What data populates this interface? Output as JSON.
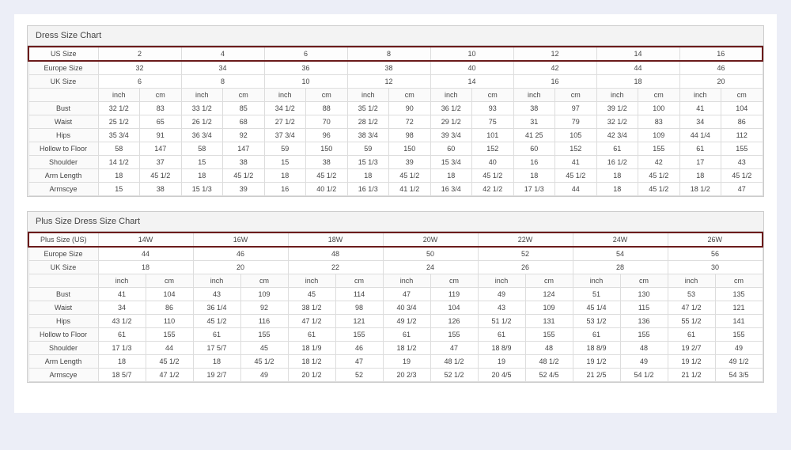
{
  "charts": [
    {
      "title": "Dress Size Chart",
      "rows": [
        {
          "label": "US Size",
          "style": "highlight",
          "span": 2,
          "cells": [
            "2",
            "4",
            "6",
            "8",
            "10",
            "12",
            "14",
            "16"
          ]
        },
        {
          "label": "Europe Size",
          "style": "",
          "span": 2,
          "cells": [
            "32",
            "34",
            "36",
            "38",
            "40",
            "42",
            "44",
            "46"
          ]
        },
        {
          "label": "UK Size",
          "style": "",
          "span": 2,
          "cells": [
            "6",
            "8",
            "10",
            "12",
            "14",
            "16",
            "18",
            "20"
          ]
        },
        {
          "label": "",
          "style": "unit",
          "span": 1,
          "cells": [
            "inch",
            "cm",
            "inch",
            "cm",
            "inch",
            "cm",
            "inch",
            "cm",
            "inch",
            "cm",
            "inch",
            "cm",
            "inch",
            "cm",
            "inch",
            "cm"
          ]
        },
        {
          "label": "Bust",
          "style": "",
          "span": 1,
          "cells": [
            "32 1/2",
            "83",
            "33 1/2",
            "85",
            "34 1/2",
            "88",
            "35 1/2",
            "90",
            "36 1/2",
            "93",
            "38",
            "97",
            "39 1/2",
            "100",
            "41",
            "104"
          ]
        },
        {
          "label": "Waist",
          "style": "",
          "span": 1,
          "cells": [
            "25 1/2",
            "65",
            "26 1/2",
            "68",
            "27 1/2",
            "70",
            "28 1/2",
            "72",
            "29 1/2",
            "75",
            "31",
            "79",
            "32 1/2",
            "83",
            "34",
            "86"
          ]
        },
        {
          "label": "Hips",
          "style": "",
          "span": 1,
          "cells": [
            "35 3/4",
            "91",
            "36 3/4",
            "92",
            "37 3/4",
            "96",
            "38 3/4",
            "98",
            "39 3/4",
            "101",
            "41 25",
            "105",
            "42 3/4",
            "109",
            "44 1/4",
            "112"
          ]
        },
        {
          "label": "Hollow to Floor",
          "style": "",
          "span": 1,
          "cells": [
            "58",
            "147",
            "58",
            "147",
            "59",
            "150",
            "59",
            "150",
            "60",
            "152",
            "60",
            "152",
            "61",
            "155",
            "61",
            "155"
          ]
        },
        {
          "label": "Shoulder",
          "style": "",
          "span": 1,
          "cells": [
            "14 1/2",
            "37",
            "15",
            "38",
            "15",
            "38",
            "15 1/3",
            "39",
            "15 3/4",
            "40",
            "16",
            "41",
            "16 1/2",
            "42",
            "17",
            "43"
          ]
        },
        {
          "label": "Arm Length",
          "style": "",
          "span": 1,
          "cells": [
            "18",
            "45 1/2",
            "18",
            "45 1/2",
            "18",
            "45 1/2",
            "18",
            "45 1/2",
            "18",
            "45 1/2",
            "18",
            "45 1/2",
            "18",
            "45 1/2",
            "18",
            "45 1/2"
          ]
        },
        {
          "label": "Armscye",
          "style": "",
          "span": 1,
          "cells": [
            "15",
            "38",
            "15 1/3",
            "39",
            "16",
            "40 1/2",
            "16 1/3",
            "41 1/2",
            "16 3/4",
            "42 1/2",
            "17 1/3",
            "44",
            "18",
            "45 1/2",
            "18 1/2",
            "47"
          ]
        }
      ]
    },
    {
      "title": "Plus Size Dress Size Chart",
      "rows": [
        {
          "label": "Plus Size (US)",
          "style": "highlight",
          "span": 2,
          "cells": [
            "14W",
            "16W",
            "18W",
            "20W",
            "22W",
            "24W",
            "26W"
          ]
        },
        {
          "label": "Europe Size",
          "style": "",
          "span": 2,
          "cells": [
            "44",
            "46",
            "48",
            "50",
            "52",
            "54",
            "56"
          ]
        },
        {
          "label": "UK Size",
          "style": "",
          "span": 2,
          "cells": [
            "18",
            "20",
            "22",
            "24",
            "26",
            "28",
            "30"
          ]
        },
        {
          "label": "",
          "style": "unit",
          "span": 1,
          "cells": [
            "inch",
            "cm",
            "inch",
            "cm",
            "inch",
            "cm",
            "inch",
            "cm",
            "inch",
            "cm",
            "inch",
            "cm",
            "inch",
            "cm"
          ]
        },
        {
          "label": "Bust",
          "style": "",
          "span": 1,
          "cells": [
            "41",
            "104",
            "43",
            "109",
            "45",
            "114",
            "47",
            "119",
            "49",
            "124",
            "51",
            "130",
            "53",
            "135"
          ]
        },
        {
          "label": "Waist",
          "style": "",
          "span": 1,
          "cells": [
            "34",
            "86",
            "36 1/4",
            "92",
            "38 1/2",
            "98",
            "40 3/4",
            "104",
            "43",
            "109",
            "45 1/4",
            "115",
            "47 1/2",
            "121"
          ]
        },
        {
          "label": "Hips",
          "style": "",
          "span": 1,
          "cells": [
            "43 1/2",
            "110",
            "45 1/2",
            "116",
            "47 1/2",
            "121",
            "49 1/2",
            "126",
            "51 1/2",
            "131",
            "53 1/2",
            "136",
            "55 1/2",
            "141"
          ]
        },
        {
          "label": "Hollow to Floor",
          "style": "",
          "span": 1,
          "cells": [
            "61",
            "155",
            "61",
            "155",
            "61",
            "155",
            "61",
            "155",
            "61",
            "155",
            "61",
            "155",
            "61",
            "155"
          ]
        },
        {
          "label": "Shoulder",
          "style": "",
          "span": 1,
          "cells": [
            "17 1/3",
            "44",
            "17 5/7",
            "45",
            "18 1/9",
            "46",
            "18 1/2",
            "47",
            "18 8/9",
            "48",
            "18 8/9",
            "48",
            "19 2/7",
            "49"
          ]
        },
        {
          "label": "Arm Length",
          "style": "",
          "span": 1,
          "cells": [
            "18",
            "45 1/2",
            "18",
            "45 1/2",
            "18 1/2",
            "47",
            "19",
            "48 1/2",
            "19",
            "48 1/2",
            "19 1/2",
            "49",
            "19 1/2",
            "49 1/2"
          ]
        },
        {
          "label": "Armscye",
          "style": "",
          "span": 1,
          "cells": [
            "18 5/7",
            "47 1/2",
            "19 2/7",
            "49",
            "20 1/2",
            "52",
            "20 2/3",
            "52 1/2",
            "20 4/5",
            "52 4/5",
            "21 2/5",
            "54 1/2",
            "21 1/2",
            "54 3/5"
          ]
        }
      ]
    }
  ]
}
